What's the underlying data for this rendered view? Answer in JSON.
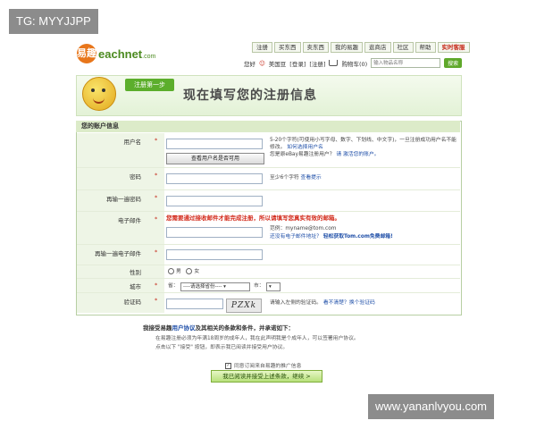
{
  "watermark_tl": "TG: MYYJJPP",
  "watermark_br": "www.yananlvyou.com",
  "logo": {
    "mark": "易趣",
    "word": "eachnet",
    "suffix": ".com"
  },
  "topnav": [
    "注册",
    "买东西",
    "卖东西",
    "我的易趣",
    "逛商店",
    "社区",
    "帮助",
    "实时客服"
  ],
  "userbar": {
    "greeting": "您好",
    "name": "美国豆",
    "login": "[登录]",
    "logout": "[注册]",
    "cart": "购物车(0)",
    "search_placeholder": "输入物品名称",
    "search_btn": "搜索"
  },
  "banner": {
    "step": "注册第一步",
    "title": "现在填写您的注册信息"
  },
  "form": {
    "section_title": "您的账户信息",
    "fields": {
      "username": {
        "label": "用户名",
        "hint1": "5-20个字符(可使用小写字母、数字、下划线、中文字)，一旦注册成功用户名不能修改。",
        "hint1_link": "如何选择用户名",
        "hint2": "您是原eBay易趣注册用户？",
        "hint2_link": "请 激活您的账户。",
        "check_btn": "查看用户名是否可用"
      },
      "password": {
        "label": "密码",
        "hint": "至少6个字符",
        "hint_link": "查看提示"
      },
      "password_confirm": {
        "label": "再输一遍密码"
      },
      "email": {
        "label": "电子邮件",
        "error": "您需要通过接收邮件才能完成注册，所以请填写您真实有效的邮箱。",
        "example": "范例：myname@tom.com",
        "no_email": "还没有电子邮件地址？",
        "free_link": "轻松获取Tom.com免费邮箱!"
      },
      "email_confirm": {
        "label": "再输一遍电子邮件"
      },
      "gender": {
        "label": "性别",
        "male": "男",
        "female": "女"
      },
      "city": {
        "label": "城市",
        "province_label": "省：",
        "province_value": "----请选择省份----",
        "city_label": "市："
      },
      "captcha": {
        "label": "验证码",
        "image_text": "PZXk",
        "hint": "请输入左侧的验证码。",
        "hint_link": "看不清楚？换个验证码"
      }
    }
  },
  "agreement": {
    "title_prefix": "我接受易趣",
    "title_link": "用户协议",
    "title_suffix": "及其相关的条款和条件，并承诺如下：",
    "line1": "在易趣注册必须为年满18周岁的成年人，我在此声明我是个成年人，可以签署用户协议。",
    "line2": "点击以下 \"接受\" 按钮，即表示我已阅读并接受用户协议。",
    "subscribe": "同意订阅来自易趣的推广信息",
    "submit": "我已阅读并接受上述条款，继续 >"
  }
}
